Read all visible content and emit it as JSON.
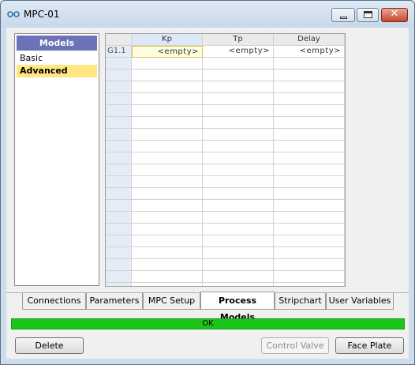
{
  "window": {
    "title": "MPC-01"
  },
  "models_panel": {
    "header": "Models",
    "items": [
      {
        "label": "Basic",
        "selected": false
      },
      {
        "label": "Advanced",
        "selected": true
      }
    ]
  },
  "grid": {
    "columns": [
      "Kp",
      "Tp",
      "Delay"
    ],
    "rows": [
      {
        "label": "G1.1",
        "values": [
          "<empty>",
          "<empty>",
          "<empty>"
        ]
      }
    ]
  },
  "tabs": [
    {
      "label": "Connections",
      "active": false
    },
    {
      "label": "Parameters",
      "active": false
    },
    {
      "label": "MPC Setup",
      "active": false
    },
    {
      "label": "Process Models",
      "active": true
    },
    {
      "label": "Stripchart",
      "active": false
    },
    {
      "label": "User Variables",
      "active": false
    }
  ],
  "status": {
    "text": "OK",
    "color": "#1bc61b"
  },
  "buttons": {
    "delete": "Delete",
    "control_valve": "Control Valve",
    "face_plate": "Face Plate"
  }
}
